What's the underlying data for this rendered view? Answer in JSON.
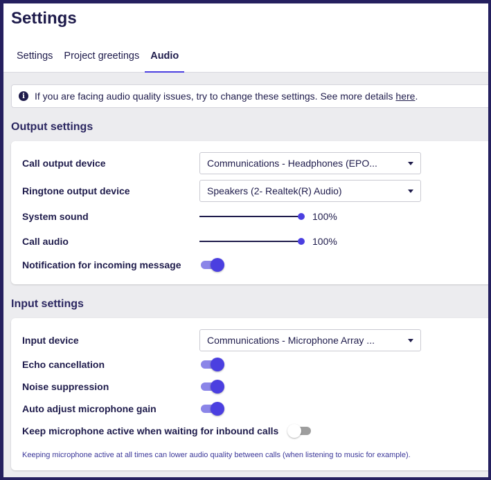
{
  "colors": {
    "accent": "#4b3fe0",
    "text": "#1e1b4b",
    "background": "#ececef",
    "window_border": "#25205f"
  },
  "page": {
    "title": "Settings"
  },
  "tabs": [
    {
      "label": "Settings",
      "active": false
    },
    {
      "label": "Project greetings",
      "active": false
    },
    {
      "label": "Audio",
      "active": true
    }
  ],
  "notice": {
    "icon": "info-icon",
    "text": "If you are facing audio quality issues, try to change these settings. See more details ",
    "link": "here",
    "suffix": "."
  },
  "output": {
    "title": "Output settings",
    "call_output_device": {
      "label": "Call output device",
      "value": "Communications - Headphones (EPO..."
    },
    "ringtone_output_device": {
      "label": "Ringtone output device",
      "value": "Speakers (2- Realtek(R) Audio)"
    },
    "system_sound": {
      "label": "System sound",
      "value": 100,
      "display": "100%"
    },
    "call_audio": {
      "label": "Call audio",
      "value": 100,
      "display": "100%"
    },
    "incoming_message_notification": {
      "label": "Notification for incoming message",
      "on": true
    }
  },
  "input": {
    "title": "Input settings",
    "input_device": {
      "label": "Input device",
      "value": "Communications - Microphone Array ..."
    },
    "echo_cancellation": {
      "label": "Echo cancellation",
      "on": true
    },
    "noise_suppression": {
      "label": "Noise suppression",
      "on": true
    },
    "auto_gain": {
      "label": "Auto adjust microphone gain",
      "on": true
    },
    "keep_mic_active": {
      "label": "Keep microphone active when waiting for inbound calls",
      "on": false
    },
    "helper_text": "Keeping microphone active at all times can lower audio quality between calls (when listening to music for example)."
  }
}
